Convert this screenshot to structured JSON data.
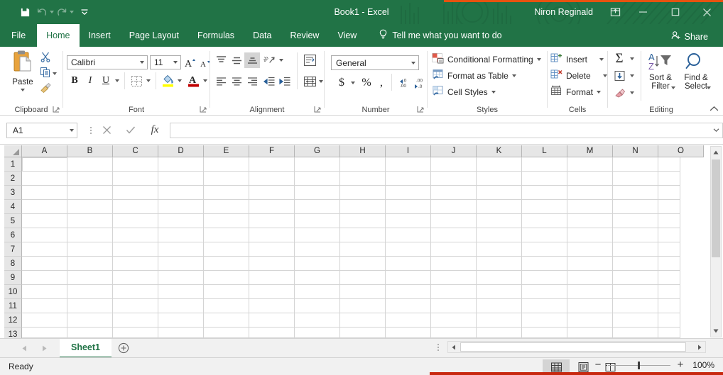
{
  "app": {
    "title": "Book1 - Excel",
    "user": "Niron Reginald",
    "theme_green": "#217346",
    "accent_orange": "#e8520f",
    "accent_red": "#c8280f"
  },
  "quick_access": {
    "items": [
      {
        "name": "save-icon",
        "label": "Save"
      },
      {
        "name": "undo-icon",
        "label": "Undo"
      },
      {
        "name": "redo-icon",
        "label": "Redo"
      },
      {
        "name": "customize-qat-icon",
        "label": "Customize Quick Access Toolbar"
      }
    ]
  },
  "window_controls": {
    "ribbon_display_options": "Ribbon Display Options",
    "minimize": "Minimize",
    "restore": "Restore Down",
    "close": "Close"
  },
  "tabs": [
    {
      "label": "File",
      "active": false
    },
    {
      "label": "Home",
      "active": true
    },
    {
      "label": "Insert",
      "active": false
    },
    {
      "label": "Page Layout",
      "active": false
    },
    {
      "label": "Formulas",
      "active": false
    },
    {
      "label": "Data",
      "active": false
    },
    {
      "label": "Review",
      "active": false
    },
    {
      "label": "View",
      "active": false
    }
  ],
  "tell_me": {
    "placeholder": "Tell me what you want to do",
    "icon": "lightbulb-icon"
  },
  "share": {
    "label": "Share",
    "icon": "share-person-icon"
  },
  "ribbon": {
    "clipboard": {
      "label": "Clipboard",
      "paste": "Paste",
      "cut": "Cut",
      "copy": "Copy",
      "format_painter": "Format Painter",
      "dialog_launcher": "Clipboard dialog box launcher"
    },
    "font": {
      "label": "Font",
      "font_name": "Calibri",
      "font_size": "11",
      "increase_font": "Increase Font Size",
      "decrease_font": "Decrease Font Size",
      "bold": "B",
      "italic": "I",
      "underline": "U",
      "borders": "Borders",
      "fill_color": "Fill Color",
      "font_color": "Font Color",
      "dialog_launcher": "Font dialog box launcher"
    },
    "alignment": {
      "label": "Alignment",
      "top_align": "Top Align",
      "middle_align": "Middle Align",
      "bottom_align": "Bottom Align",
      "orientation": "Orientation",
      "align_left": "Align Left",
      "center": "Center",
      "align_right": "Align Right",
      "decrease_indent": "Decrease Indent",
      "increase_indent": "Increase Indent",
      "wrap_text": "Wrap Text",
      "merge_and_center": "Merge & Center",
      "dialog_launcher": "Alignment dialog box launcher"
    },
    "number": {
      "label": "Number",
      "format": "General",
      "accounting": "Accounting Number Format",
      "percent": "Percent Style",
      "comma": "Comma Style",
      "increase_decimal": "Increase Decimal",
      "decrease_decimal": "Decrease Decimal",
      "dialog_launcher": "Number dialog box launcher"
    },
    "styles": {
      "label": "Styles",
      "items": [
        {
          "label": "Conditional Formatting",
          "icon": "conditional-formatting-icon"
        },
        {
          "label": "Format as Table",
          "icon": "format-as-table-icon"
        },
        {
          "label": "Cell Styles",
          "icon": "cell-styles-icon"
        }
      ]
    },
    "cells": {
      "label": "Cells",
      "items": [
        {
          "label": "Insert",
          "icon": "insert-cells-icon"
        },
        {
          "label": "Delete",
          "icon": "delete-cells-icon"
        },
        {
          "label": "Format",
          "icon": "format-cells-icon"
        }
      ]
    },
    "editing": {
      "label": "Editing",
      "autosum": "AutoSum",
      "fill": "Fill",
      "clear": "Clear",
      "sort_filter": "Sort & Filter",
      "find_select": "Find & Select",
      "collapse_ribbon": "Collapse the Ribbon"
    }
  },
  "formula_bar": {
    "name_box": "A1",
    "cancel": "Cancel",
    "enter": "Enter",
    "insert_function": "fx",
    "value": "",
    "expand": "Expand Formula Bar"
  },
  "grid": {
    "columns": [
      "A",
      "B",
      "C",
      "D",
      "E",
      "F",
      "G",
      "H",
      "I",
      "J",
      "K",
      "L",
      "M",
      "N",
      "O"
    ],
    "rows": [
      "1",
      "2",
      "3",
      "4",
      "5",
      "6",
      "7",
      "8",
      "9",
      "10",
      "11",
      "12",
      "13"
    ],
    "active_cell": "A1",
    "select_all": "Select All"
  },
  "sheet_bar": {
    "prev": "Previous Sheet",
    "next": "Next Sheet",
    "sheets": [
      {
        "label": "Sheet1",
        "active": true
      }
    ],
    "add_sheet": "New sheet"
  },
  "status_bar": {
    "status": "Ready",
    "views": [
      {
        "name": "normal-view-icon",
        "label": "Normal",
        "selected": true
      },
      {
        "name": "page-layout-view-icon",
        "label": "Page Layout",
        "selected": false
      },
      {
        "name": "page-break-view-icon",
        "label": "Page Break Preview",
        "selected": false
      }
    ],
    "zoom_out": "Zoom Out",
    "zoom_in": "Zoom In",
    "zoom_level": "100%"
  }
}
